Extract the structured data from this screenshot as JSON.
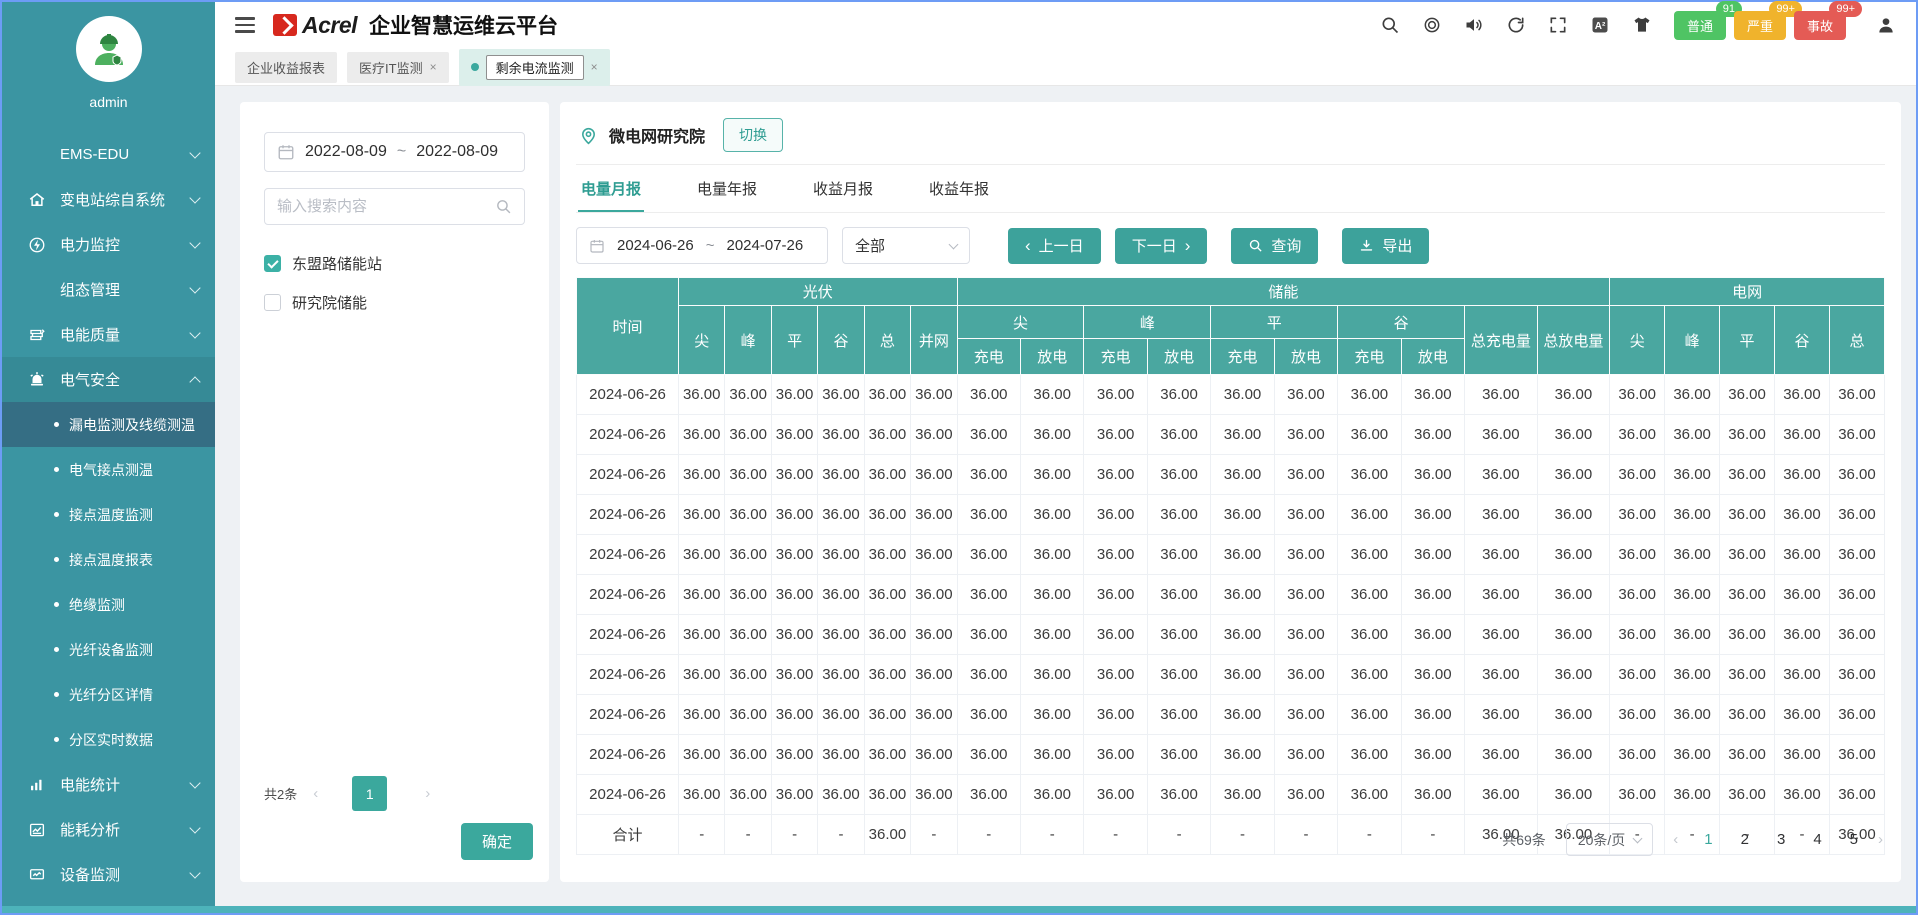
{
  "colors": {
    "accent": "#3ba89d",
    "sidebar": "#3b95a2",
    "table_header": "#4aa7a0",
    "badge_green": "#4fc464",
    "badge_yellow": "#f0b32c",
    "badge_red": "#e45b55"
  },
  "header": {
    "brand": "Acrel",
    "title": "企业智慧运维云平台",
    "alarm_badges": [
      {
        "label": "普通",
        "count": "91",
        "color": "#4fc464"
      },
      {
        "label": "严重",
        "count": "99+",
        "color": "#f0b32c"
      },
      {
        "label": "事故",
        "count": "99+",
        "color": "#e45b55"
      }
    ]
  },
  "workspace_tabs": [
    {
      "label": "企业收益报表",
      "closable": false,
      "active": false
    },
    {
      "label": "医疗IT监测",
      "closable": true,
      "active": false
    },
    {
      "label": "剩余电流监测",
      "closable": true,
      "active": true
    }
  ],
  "sidebar": {
    "user": "admin",
    "items": [
      {
        "label": "EMS-EDU",
        "icon": ""
      },
      {
        "label": "变电站综自系统",
        "icon": "home-icon"
      },
      {
        "label": "电力监控",
        "icon": "power-monitor-icon"
      },
      {
        "label": "组态管理",
        "icon": ""
      },
      {
        "label": "电能质量",
        "icon": "power-quality-icon"
      },
      {
        "label": "电气安全",
        "icon": "electrical-safety-icon",
        "expanded": true,
        "children": [
          {
            "label": "漏电监测及线缆测温",
            "active": true
          },
          {
            "label": "电气接点测温"
          },
          {
            "label": "接点温度监测"
          },
          {
            "label": "接点温度报表"
          },
          {
            "label": "绝缘监测"
          },
          {
            "label": "光纤设备监测"
          },
          {
            "label": "光纤分区详情"
          },
          {
            "label": "分区实时数据"
          }
        ]
      },
      {
        "label": "电能统计",
        "icon": "energy-stats-icon"
      },
      {
        "label": "能耗分析",
        "icon": "energy-analysis-icon"
      },
      {
        "label": "设备监测",
        "icon": "device-monitor-icon"
      }
    ]
  },
  "filter_panel": {
    "date_start": "2022-08-09",
    "date_separator": "~",
    "date_end": "2022-08-09",
    "search_placeholder": "输入搜索内容",
    "stations": [
      {
        "label": "东盟路储能站",
        "checked": true
      },
      {
        "label": "研究院储能",
        "checked": false
      }
    ],
    "total_text": "共2条",
    "current_page": "1",
    "confirm_label": "确定"
  },
  "main": {
    "station_name": "微电网研究院",
    "switch_label": "切换",
    "report_tabs": [
      {
        "label": "电量月报",
        "active": true
      },
      {
        "label": "电量年报",
        "active": false
      },
      {
        "label": "收益月报",
        "active": false
      },
      {
        "label": "收益年报",
        "active": false
      }
    ],
    "toolbar": {
      "date_start": "2024-06-26",
      "date_separator": "~",
      "date_end": "2024-07-26",
      "filter_value": "全部",
      "prev_label": "上一日",
      "next_label": "下一日",
      "query_label": "查询",
      "export_label": "导出"
    }
  },
  "table": {
    "time_header": "时间",
    "pv_group": {
      "label": "光伏",
      "children": [
        "尖",
        "峰",
        "平",
        "谷",
        "总",
        "并网"
      ]
    },
    "storage_group": {
      "label": "储能",
      "subgroups": [
        {
          "label": "尖"
        },
        {
          "label": "峰"
        },
        {
          "label": "平"
        },
        {
          "label": "谷"
        }
      ],
      "charge_label": "充电",
      "discharge_label": "放电",
      "total_charge": "总充电量",
      "total_discharge": "总放电量"
    },
    "grid_group": {
      "label": "电网",
      "children": [
        "尖",
        "峰",
        "平",
        "谷",
        "总"
      ]
    },
    "rows": [
      {
        "date": "2024-06-26",
        "values": [
          "36.00",
          "36.00",
          "36.00",
          "36.00",
          "36.00",
          "36.00",
          "36.00",
          "36.00",
          "36.00",
          "36.00",
          "36.00",
          "36.00",
          "36.00",
          "36.00",
          "36.00",
          "36.00",
          "36.00",
          "36.00",
          "36.00",
          "36.00",
          "36.00"
        ]
      },
      {
        "date": "2024-06-26",
        "values": [
          "36.00",
          "36.00",
          "36.00",
          "36.00",
          "36.00",
          "36.00",
          "36.00",
          "36.00",
          "36.00",
          "36.00",
          "36.00",
          "36.00",
          "36.00",
          "36.00",
          "36.00",
          "36.00",
          "36.00",
          "36.00",
          "36.00",
          "36.00",
          "36.00"
        ]
      },
      {
        "date": "2024-06-26",
        "values": [
          "36.00",
          "36.00",
          "36.00",
          "36.00",
          "36.00",
          "36.00",
          "36.00",
          "36.00",
          "36.00",
          "36.00",
          "36.00",
          "36.00",
          "36.00",
          "36.00",
          "36.00",
          "36.00",
          "36.00",
          "36.00",
          "36.00",
          "36.00",
          "36.00"
        ]
      },
      {
        "date": "2024-06-26",
        "values": [
          "36.00",
          "36.00",
          "36.00",
          "36.00",
          "36.00",
          "36.00",
          "36.00",
          "36.00",
          "36.00",
          "36.00",
          "36.00",
          "36.00",
          "36.00",
          "36.00",
          "36.00",
          "36.00",
          "36.00",
          "36.00",
          "36.00",
          "36.00",
          "36.00"
        ]
      },
      {
        "date": "2024-06-26",
        "values": [
          "36.00",
          "36.00",
          "36.00",
          "36.00",
          "36.00",
          "36.00",
          "36.00",
          "36.00",
          "36.00",
          "36.00",
          "36.00",
          "36.00",
          "36.00",
          "36.00",
          "36.00",
          "36.00",
          "36.00",
          "36.00",
          "36.00",
          "36.00",
          "36.00"
        ]
      },
      {
        "date": "2024-06-26",
        "values": [
          "36.00",
          "36.00",
          "36.00",
          "36.00",
          "36.00",
          "36.00",
          "36.00",
          "36.00",
          "36.00",
          "36.00",
          "36.00",
          "36.00",
          "36.00",
          "36.00",
          "36.00",
          "36.00",
          "36.00",
          "36.00",
          "36.00",
          "36.00",
          "36.00"
        ]
      },
      {
        "date": "2024-06-26",
        "values": [
          "36.00",
          "36.00",
          "36.00",
          "36.00",
          "36.00",
          "36.00",
          "36.00",
          "36.00",
          "36.00",
          "36.00",
          "36.00",
          "36.00",
          "36.00",
          "36.00",
          "36.00",
          "36.00",
          "36.00",
          "36.00",
          "36.00",
          "36.00",
          "36.00"
        ]
      },
      {
        "date": "2024-06-26",
        "values": [
          "36.00",
          "36.00",
          "36.00",
          "36.00",
          "36.00",
          "36.00",
          "36.00",
          "36.00",
          "36.00",
          "36.00",
          "36.00",
          "36.00",
          "36.00",
          "36.00",
          "36.00",
          "36.00",
          "36.00",
          "36.00",
          "36.00",
          "36.00",
          "36.00"
        ]
      },
      {
        "date": "2024-06-26",
        "values": [
          "36.00",
          "36.00",
          "36.00",
          "36.00",
          "36.00",
          "36.00",
          "36.00",
          "36.00",
          "36.00",
          "36.00",
          "36.00",
          "36.00",
          "36.00",
          "36.00",
          "36.00",
          "36.00",
          "36.00",
          "36.00",
          "36.00",
          "36.00",
          "36.00"
        ]
      },
      {
        "date": "2024-06-26",
        "values": [
          "36.00",
          "36.00",
          "36.00",
          "36.00",
          "36.00",
          "36.00",
          "36.00",
          "36.00",
          "36.00",
          "36.00",
          "36.00",
          "36.00",
          "36.00",
          "36.00",
          "36.00",
          "36.00",
          "36.00",
          "36.00",
          "36.00",
          "36.00",
          "36.00"
        ]
      },
      {
        "date": "2024-06-26",
        "values": [
          "36.00",
          "36.00",
          "36.00",
          "36.00",
          "36.00",
          "36.00",
          "36.00",
          "36.00",
          "36.00",
          "36.00",
          "36.00",
          "36.00",
          "36.00",
          "36.00",
          "36.00",
          "36.00",
          "36.00",
          "36.00",
          "36.00",
          "36.00",
          "36.00"
        ]
      }
    ],
    "total_row": {
      "label": "合计",
      "values": [
        "-",
        "-",
        "-",
        "-",
        "36.00",
        "-",
        "-",
        "-",
        "-",
        "-",
        "-",
        "-",
        "-",
        "-",
        "36.00",
        "36.00",
        "-",
        "-",
        "-",
        "-",
        "36.00"
      ]
    }
  },
  "pagination": {
    "total_text": "共69条",
    "page_size": "20条/页",
    "pages": [
      "1",
      "2",
      "3",
      "4",
      "5"
    ],
    "active_page": "1"
  }
}
